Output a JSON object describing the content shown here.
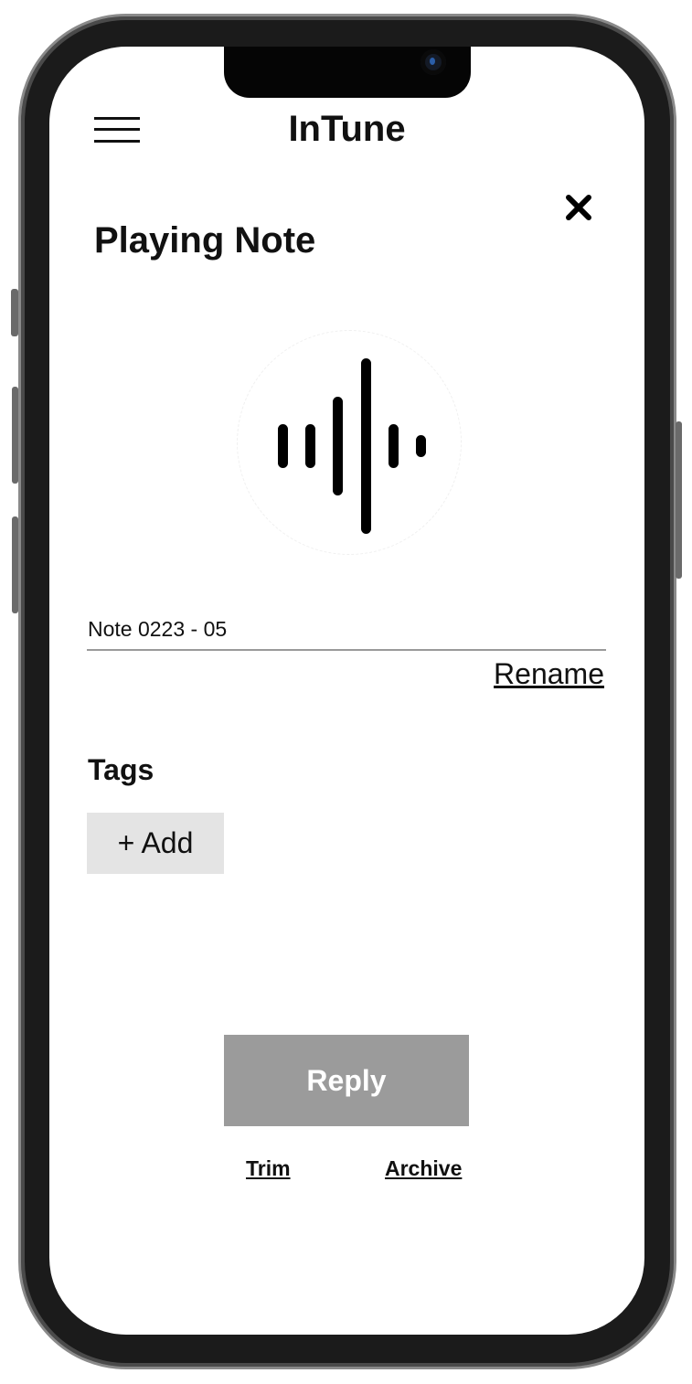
{
  "header": {
    "app_title": "InTune"
  },
  "page": {
    "title": "Playing Note"
  },
  "icons": {
    "menu": "hamburger-menu-icon",
    "close": "close-icon",
    "waveform": "waveform-icon"
  },
  "note": {
    "name": "Note 0223 - 05",
    "rename_label": "Rename"
  },
  "tags": {
    "label": "Tags",
    "add_label": "+ Add"
  },
  "actions": {
    "reply_label": "Reply",
    "trim_label": "Trim",
    "archive_label": "Archive"
  },
  "colors": {
    "reply_button_bg": "#9b9b9b",
    "add_button_bg": "#e4e4e4",
    "text": "#111111"
  }
}
